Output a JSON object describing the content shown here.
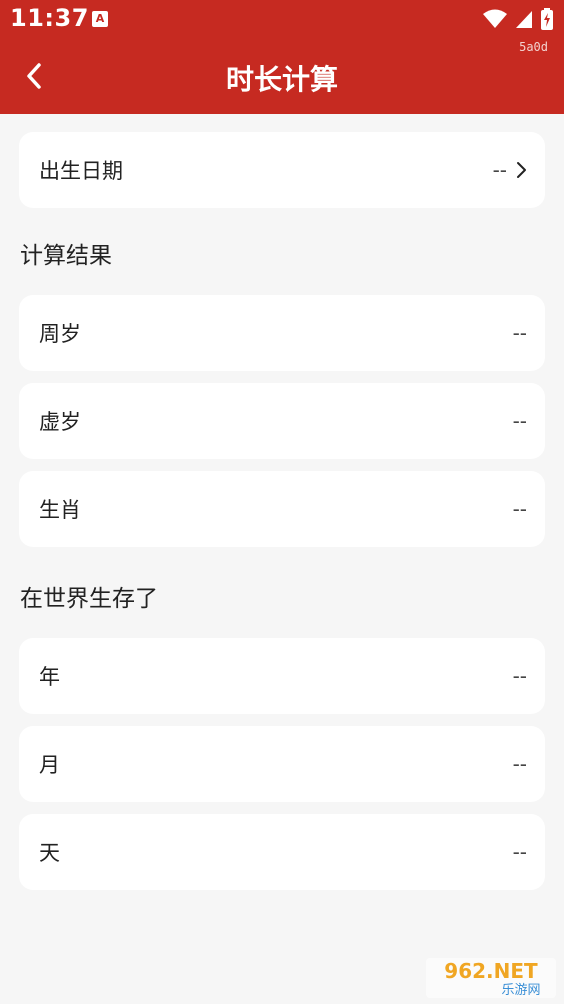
{
  "status_bar": {
    "time": "11:37",
    "notif_badge": "A",
    "debug": "5a0d"
  },
  "appbar": {
    "title": "时长计算"
  },
  "birth": {
    "label": "出生日期",
    "value": "--"
  },
  "results": {
    "title": "计算结果",
    "items": [
      {
        "label": "周岁",
        "value": "--"
      },
      {
        "label": "虚岁",
        "value": "--"
      },
      {
        "label": "生肖",
        "value": "--"
      }
    ]
  },
  "alive": {
    "title": "在世界生存了",
    "items": [
      {
        "label": "年",
        "value": "--"
      },
      {
        "label": "月",
        "value": "--"
      },
      {
        "label": "天",
        "value": "--"
      }
    ]
  },
  "watermark": {
    "brand": "962.NET",
    "sub": "乐游网"
  },
  "colors": {
    "primary": "#c62a21",
    "background": "#f6f6f6",
    "card": "#ffffff"
  }
}
